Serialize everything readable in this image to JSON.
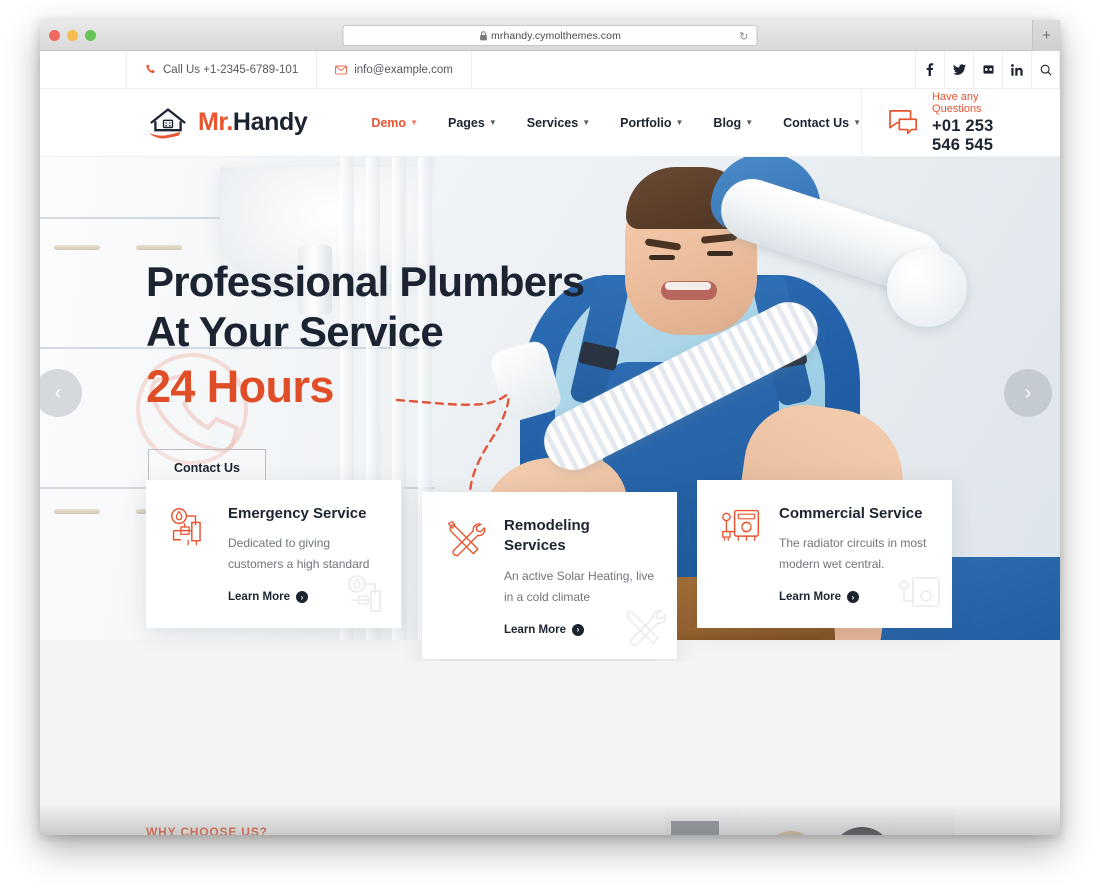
{
  "browser": {
    "url": "mrhandy.cymolthemes.com",
    "lock_icon": "lock-icon",
    "reload_icon": "reload-icon",
    "new_tab_label": "+"
  },
  "topbar": {
    "phone": "Call Us +1-2345-6789-101",
    "email": "info@example.com",
    "socials": [
      {
        "name": "facebook-icon",
        "glyph": "f"
      },
      {
        "name": "twitter-icon",
        "glyph": "t"
      },
      {
        "name": "dribbble-icon",
        "glyph": "d"
      },
      {
        "name": "linkedin-icon",
        "glyph": "in"
      },
      {
        "name": "search-icon",
        "glyph": "q"
      }
    ]
  },
  "header": {
    "logo": {
      "first": "Mr.",
      "second": "Handy"
    },
    "nav": [
      {
        "label": "Demo",
        "active": true
      },
      {
        "label": "Pages",
        "active": false
      },
      {
        "label": "Services",
        "active": false
      },
      {
        "label": "Portfolio",
        "active": false
      },
      {
        "label": "Blog",
        "active": false
      },
      {
        "label": "Contact Us",
        "active": false
      }
    ],
    "questions_label": "Have any Questions",
    "questions_phone": "+01 253 546 545"
  },
  "hero": {
    "title_line1": "Professional Plumbers",
    "title_line2": "At Your Service",
    "highlight": "24 Hours",
    "cta": "Contact Us",
    "prev_arrow": "‹",
    "next_arrow": "›"
  },
  "cards": [
    {
      "title": "Emergency Service",
      "desc": "Dedicated to giving customers a high standard",
      "link": "Learn More",
      "icon": "pipe-valve-icon"
    },
    {
      "title": "Remodeling Services",
      "desc": "An active Solar Heating, live in a cold climate",
      "link": "Learn More",
      "icon": "crossed-tools-icon"
    },
    {
      "title": "Commercial Service",
      "desc": "The radiator circuits in most modern wet central.",
      "link": "Learn More",
      "icon": "boiler-meter-icon"
    }
  ],
  "why": {
    "kicker": "WHY CHOOSE US?"
  },
  "colors": {
    "accent": "#e8542f",
    "accent_dark": "#e04e28",
    "ink": "#1d2431",
    "muted": "#70757d",
    "page_bg": "#f4f4f4"
  }
}
